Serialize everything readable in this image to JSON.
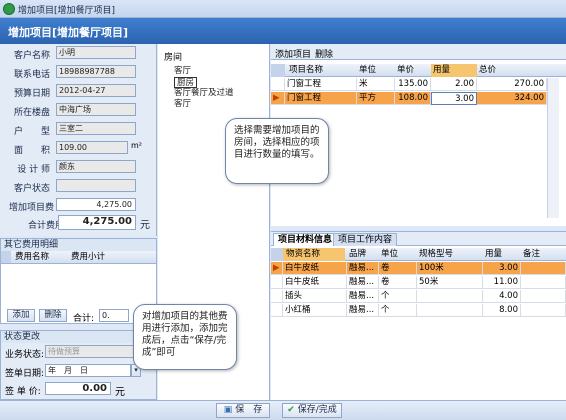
{
  "window": {
    "title": "增加项目[增加餐厅项目]"
  },
  "header": {
    "title": "增加项目[增加餐厅项目]"
  },
  "form": {
    "fields": [
      {
        "label": "客户名称",
        "value": "小明"
      },
      {
        "label": "联系电话",
        "value": "18988987788"
      },
      {
        "label": "预算日期",
        "value": "2012-04-27"
      },
      {
        "label": "所在楼盘",
        "value": "中海广场"
      },
      {
        "label": "户　　型",
        "value": "三室二"
      },
      {
        "label": "面　　积",
        "value": "109.00"
      },
      {
        "label": "设 计 师",
        "value": "颜东"
      },
      {
        "label": "客户状态",
        "value": ""
      },
      {
        "label": "增加项目费",
        "value": "4,275.00"
      }
    ],
    "area_unit": "m²",
    "total_label": "合计费用",
    "total_value": "4,275.00",
    "total_unit": "元"
  },
  "other_fee": {
    "title": "其它费用明细",
    "columns": [
      "费用名称",
      "费用小计"
    ],
    "add_label": "添加",
    "delete_label": "删除",
    "sum_label": "合计:",
    "sum_value": "0."
  },
  "status": {
    "title": "状态更改",
    "business_label": "业务状态:",
    "business_value": "待做预算",
    "sign_date_label": "签单日期:",
    "sign_date_value": "年　月　日",
    "sign_price_label": "签 单 价:",
    "sign_price_value": "0.00",
    "sign_price_unit": "元"
  },
  "rooms": {
    "title": "房间",
    "items": [
      "客厅",
      "厨房",
      "客厅餐厅及过道",
      "客厅"
    ],
    "selected_index": 1
  },
  "items_toolbar": {
    "add_label": "添加项目",
    "delete_label": "删除"
  },
  "items_grid": {
    "columns": [
      "项目名称",
      "单位",
      "单价",
      "用量",
      "总价"
    ],
    "rows": [
      {
        "name": "门窗工程",
        "unit": "米",
        "price": "135.00",
        "qty": "2.00",
        "total": "270.00"
      },
      {
        "name": "门窗工程",
        "unit": "平方",
        "price": "108.00",
        "qty": "3.00",
        "total": "324.00"
      }
    ],
    "selected_row": 1
  },
  "tabs": [
    "项目材料信息",
    "项目工作内容"
  ],
  "material_grid": {
    "columns": [
      "物资名称",
      "品牌",
      "单位",
      "规格型号",
      "用量",
      "备注"
    ],
    "rows": [
      {
        "name": "白牛皮纸",
        "brand": "融易...",
        "unit": "卷",
        "spec": "100米",
        "qty": "3.00",
        "note": ""
      },
      {
        "name": "白牛皮纸",
        "brand": "融易...",
        "unit": "卷",
        "spec": "50米",
        "qty": "11.00",
        "note": ""
      },
      {
        "name": "插头",
        "brand": "融易...",
        "unit": "个",
        "spec": "",
        "qty": "4.00",
        "note": ""
      },
      {
        "name": "小红桶",
        "brand": "融易...",
        "unit": "个",
        "spec": "",
        "qty": "8.00",
        "note": ""
      }
    ],
    "selected_row": 0
  },
  "callouts": {
    "top": "选择需要增加项目的房间，选择相应的项目进行数量的填写。",
    "bottom": "对增加项目的其他费用进行添加，添加完成后，点击“保存/完成”即可"
  },
  "footer": {
    "save_label": "保　存",
    "save_complete_label": "保存/完成"
  },
  "colors": {
    "header": "#2b63b0",
    "selected_row": "#f7a34a",
    "panel": "#e3ebf7"
  }
}
